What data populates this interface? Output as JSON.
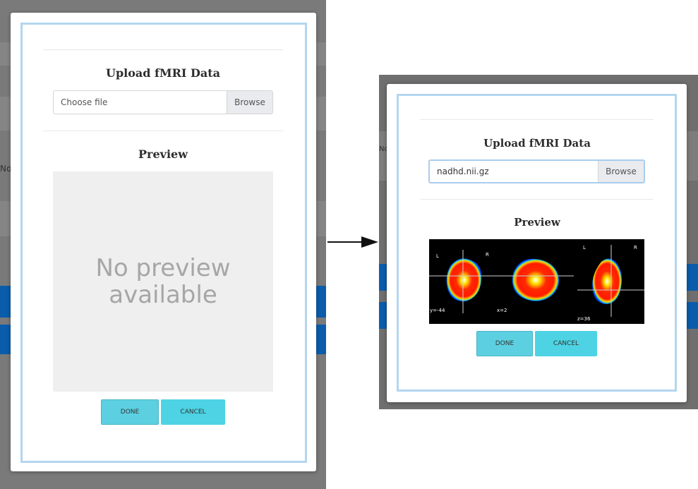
{
  "left": {
    "background_text": "No",
    "modal": {
      "title": "Upload fMRI Data",
      "file_placeholder": "Choose file",
      "browse_label": "Browse",
      "preview_heading": "Preview",
      "preview_empty_text": "No preview available",
      "done_label": "DONE",
      "cancel_label": "CANCEL"
    }
  },
  "right": {
    "background_text": "No",
    "modal": {
      "title": "Upload fMRI Data",
      "file_value": "nadhd.nii.gz",
      "browse_label": "Browse",
      "preview_heading": "Preview",
      "brain_views": [
        {
          "left_label": "L",
          "right_label": "R",
          "coord": "y=-44"
        },
        {
          "right_label": "R",
          "coord": "x=2"
        },
        {
          "left_label": "L",
          "right_label": "R",
          "coord": "z=36"
        }
      ],
      "done_label": "DONE",
      "cancel_label": "CANCEL"
    }
  },
  "colors": {
    "overlay": "#7a7a7a",
    "modal_frame": "#b3d6ef",
    "button": "#5cd0e0",
    "background_accent": "#0b5cab"
  }
}
